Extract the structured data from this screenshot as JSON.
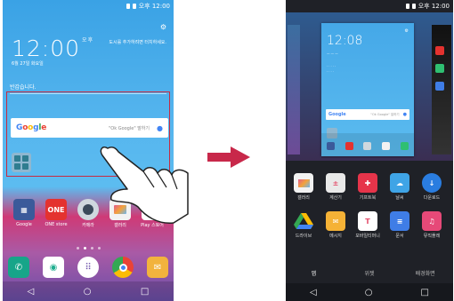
{
  "phone_left": {
    "status_time": "오후 12:00",
    "clock": "12:00",
    "clock_ampm": "오후",
    "date": "6월 27일 화요일",
    "weather_text": "도시를 추가하려면 터치하세요.",
    "greeting": "반갑습니다.",
    "search": {
      "logo": "Google",
      "hint": "\"Ok Google\" 말하기"
    },
    "apps": [
      {
        "label": "Google",
        "icon": "google-folder-icon",
        "color": "#3b5a9a"
      },
      {
        "label": "ONE store",
        "icon": "one-store-icon",
        "color": "#e4322f"
      },
      {
        "label": "카메라",
        "icon": "camera-icon",
        "color": "#cfd8de"
      },
      {
        "label": "갤러리",
        "icon": "gallery-icon",
        "color": "#f2f2f2"
      },
      {
        "label": "Play 스토어",
        "icon": "play-store-icon",
        "color": "#ffffff"
      }
    ],
    "dock": [
      {
        "icon": "phone-icon",
        "color": "#17a589"
      },
      {
        "icon": "contacts-icon",
        "color": "#1fae8f"
      },
      {
        "icon": "apps-icon",
        "color": "#ffffff"
      },
      {
        "icon": "chrome-icon",
        "color": "#ffffff"
      },
      {
        "icon": "email-icon",
        "color": "#f2b33d"
      }
    ],
    "nav": [
      "◁",
      "○",
      "□"
    ]
  },
  "phone_right": {
    "status_time": "오후 12:00",
    "preview": {
      "clock": "12:08",
      "search_logo": "Google",
      "search_hint": "\"Ok Google\" 말하기"
    },
    "apps_row1": [
      {
        "label": "갤러리",
        "icon": "gallery-icon",
        "color": "#f2f2f2"
      },
      {
        "label": "계산기",
        "icon": "calculator-icon",
        "color": "#e9e9e9"
      },
      {
        "label": "기프트북",
        "icon": "gift-icon",
        "color": "#e6344a"
      },
      {
        "label": "날씨",
        "icon": "weather-icon",
        "color": "#3fa4e6"
      },
      {
        "label": "다운로드",
        "icon": "download-icon",
        "color": "#2a7de0"
      }
    ],
    "apps_row2": [
      {
        "label": "드라이브",
        "icon": "drive-icon",
        "color": "#ffffff"
      },
      {
        "label": "메시지",
        "icon": "message-icon",
        "color": "#f5b236"
      },
      {
        "label": "모바일티머니",
        "icon": "tmoney-icon",
        "color": "#e44d6b"
      },
      {
        "label": "문서",
        "icon": "docs-icon",
        "color": "#3f7de6"
      },
      {
        "label": "뮤직플레",
        "icon": "music-icon",
        "color": "#e64978"
      }
    ],
    "tabs": [
      "앱",
      "위젯",
      "배경화면"
    ],
    "nav": [
      "◁",
      "○",
      "□"
    ]
  },
  "accent": "#c72b41"
}
